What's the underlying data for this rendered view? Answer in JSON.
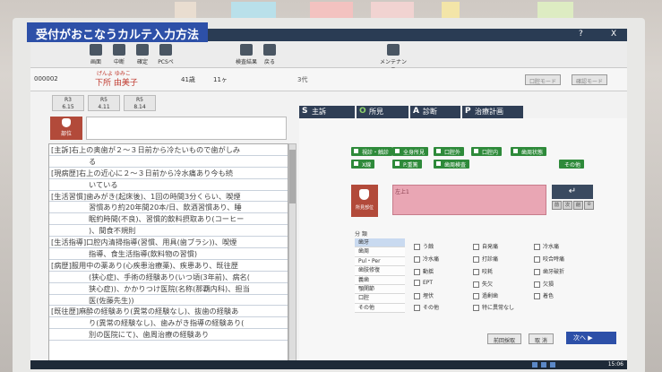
{
  "caption": "受付がおこなうカルテ入力方法",
  "window": {
    "help": "?",
    "close": "X"
  },
  "toolbar": [
    {
      "label": "画面",
      "icon": "monitor-icon"
    },
    {
      "label": "中断",
      "icon": "pause-icon"
    },
    {
      "label": "確定",
      "icon": "check-icon"
    },
    {
      "label": "PCSペ",
      "icon": "pcs-icon"
    },
    {
      "label": "検査結果",
      "icon": "printer-icon"
    },
    {
      "label": "戻る",
      "icon": "back-arrow-icon"
    },
    {
      "label": "メンテナンス",
      "icon": "maintenance-icon"
    }
  ],
  "patient": {
    "id": "000002",
    "kana": "げんよ ゆみこ",
    "name": "下所 由美子",
    "age": "41歳",
    "age2": "11ヶ",
    "mid": "3代",
    "mode1": "口腔モード",
    "mode2": "確認モード"
  },
  "visit_dates": [
    {
      "rx": "R3",
      "date": "6.15"
    },
    {
      "rx": "R5",
      "date": "4.11"
    },
    {
      "rx": "R5",
      "date": "8.14"
    }
  ],
  "tooth_label": "部位",
  "notes": [
    {
      "text": "[主訴]右上の奥歯が２～３日前から冷たいもので歯がしみ",
      "indent": false
    },
    {
      "text": "る",
      "indent": true
    },
    {
      "text": "[現病歴]右上の近心に２～３日前から冷水痛あり今も続",
      "indent": false
    },
    {
      "text": "いている",
      "indent": true
    },
    {
      "text": "[生活習慣]歯みがき(起床後)、1回の時間3分くらい、喫煙",
      "indent": false
    },
    {
      "text": "習慣あり約20年間20本/日、飲酒習慣あり、睡",
      "indent": true
    },
    {
      "text": "眠約時間(不良)、習慣的飲料摂取あり(コーヒー",
      "indent": true
    },
    {
      "text": ")、間食不規則",
      "indent": true
    },
    {
      "text": "[生活指導]口腔内清掃指導(習慣、用具(歯ブラシ))、喫煙",
      "indent": false
    },
    {
      "text": "指導、食生活指導(飲料物の習慣)",
      "indent": true
    },
    {
      "text": "[病歴]服用中の薬あり(心疾患治療薬)、疾患あり、既往歴",
      "indent": false
    },
    {
      "text": "(狭心症)、手術の経験あり(いつ頃(3年前)、病名(",
      "indent": true
    },
    {
      "text": "狭心症))、かかりつけ医院(名称(那覇内科)、担当",
      "indent": true
    },
    {
      "text": "医(佐藤先生))",
      "indent": true
    },
    {
      "text": "[既往歴]麻酔の経験あり(異常の経験なし)、抜歯の経験あ",
      "indent": false
    },
    {
      "text": "り(異常の経験なし)、歯みがき指導の経験あり(",
      "indent": true
    },
    {
      "text": "別の医院にて)、歯周治療の経験あり",
      "indent": true
    }
  ],
  "tabs": [
    {
      "key": "S",
      "label": "主訴"
    },
    {
      "key": "O",
      "label": "所見"
    },
    {
      "key": "A",
      "label": "診断"
    },
    {
      "key": "P",
      "label": "治療計画"
    }
  ],
  "green_buttons": [
    "視診・触診",
    "全身所見",
    "口腔外",
    "口腔内",
    "歯周状態",
    "X線",
    "P.重篤",
    "歯周検査",
    "その他"
  ],
  "dental_label": "所見部位",
  "pink_input_value": "左上1",
  "enter_key": "↵",
  "mini_keys": [
    "前",
    "次",
    "削",
    "⊙"
  ],
  "category": {
    "title": "分 類",
    "items": [
      "歯牙",
      "歯周",
      "Pul・Per",
      "歯肢修復",
      "義歯",
      "顎関節",
      "口腔",
      "その他"
    ],
    "selected": 0
  },
  "checks": [
    [
      "う蝕",
      "冷水痛",
      "動揺",
      "EPT",
      "埋伏",
      "その他"
    ],
    [
      "自発痛",
      "打診痛",
      "咬耗",
      "失欠",
      "過剰歯",
      "特に異常なし"
    ],
    [
      "冷水痛",
      "咬合時痛",
      "歯牙破折",
      "欠損",
      "着色"
    ]
  ],
  "nav": {
    "prev": "前回採取",
    "cancel": "取 消",
    "next": "次へ"
  },
  "taskbar": {
    "clock": "15:06"
  }
}
